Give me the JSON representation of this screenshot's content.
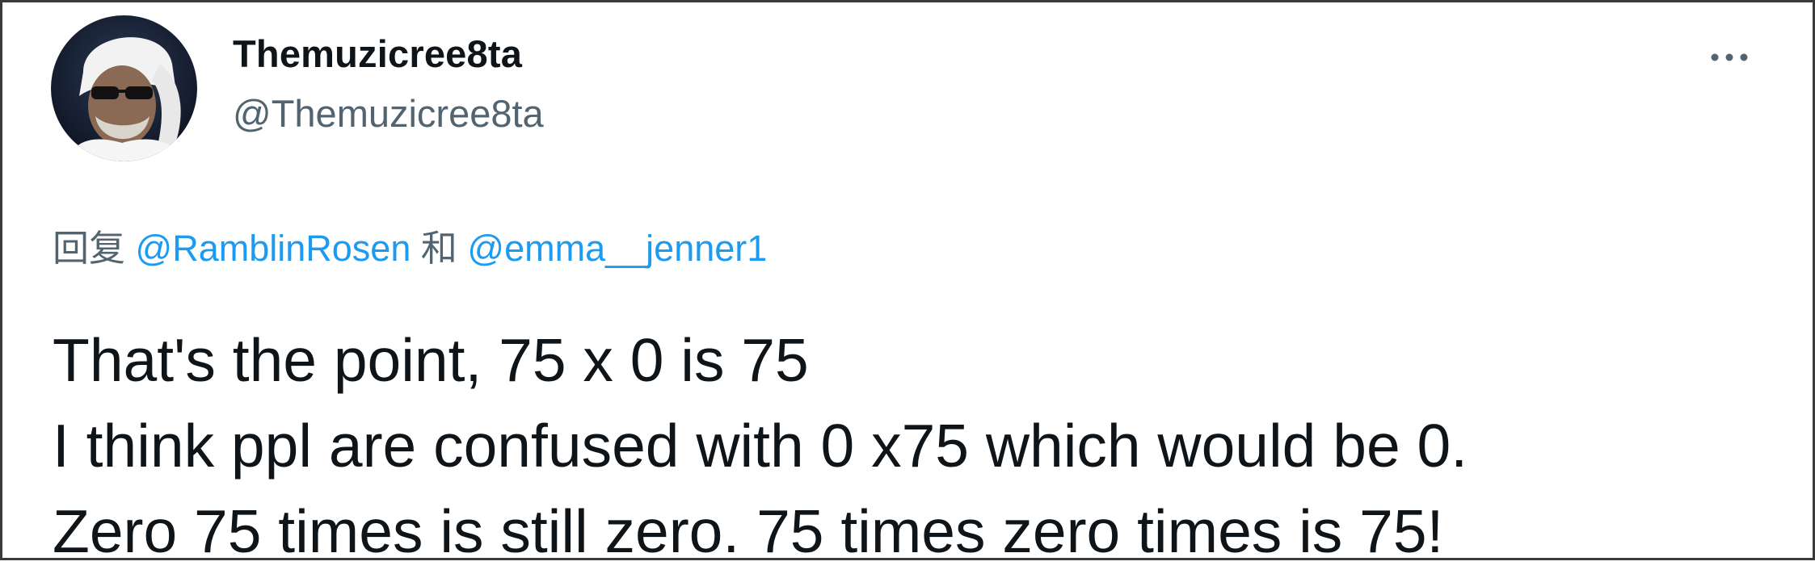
{
  "author": {
    "display_name": "Themuzicree8ta",
    "handle": "@Themuzicree8ta",
    "avatar_icon": "user-avatar"
  },
  "menu": {
    "more_icon": "more-horizontal-icon"
  },
  "reply": {
    "prefix": "回复",
    "mention_1": "@RamblinRosen",
    "joiner": "和",
    "mention_2": "@emma__jenner1"
  },
  "tweet": {
    "lines": [
      "That's the point, 75 x 0 is 75",
      "I think ppl are confused with 0 x75 which would be 0.",
      "Zero 75 times is still zero. 75 times zero times is 75!"
    ]
  },
  "colors": {
    "text_primary": "#0f1419",
    "text_secondary": "#536471",
    "link": "#1d9bf0",
    "frame_border": "#3a3a3a"
  }
}
